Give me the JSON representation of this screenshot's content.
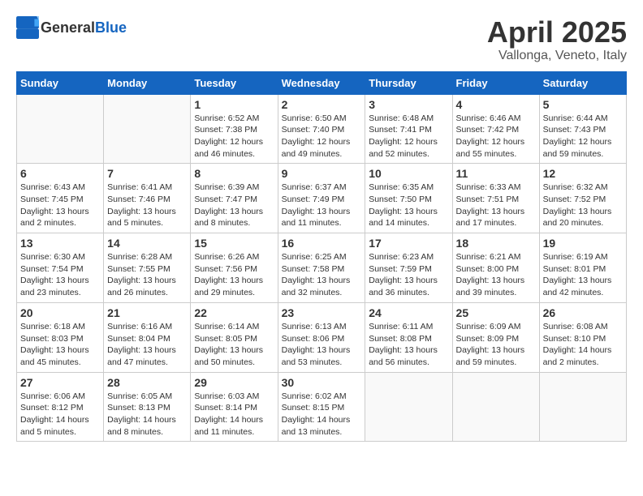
{
  "header": {
    "logo_general": "General",
    "logo_blue": "Blue",
    "month": "April 2025",
    "location": "Vallonga, Veneto, Italy"
  },
  "weekdays": [
    "Sunday",
    "Monday",
    "Tuesday",
    "Wednesday",
    "Thursday",
    "Friday",
    "Saturday"
  ],
  "weeks": [
    [
      {
        "day": "",
        "info": ""
      },
      {
        "day": "",
        "info": ""
      },
      {
        "day": "1",
        "info": "Sunrise: 6:52 AM\nSunset: 7:38 PM\nDaylight: 12 hours\nand 46 minutes."
      },
      {
        "day": "2",
        "info": "Sunrise: 6:50 AM\nSunset: 7:40 PM\nDaylight: 12 hours\nand 49 minutes."
      },
      {
        "day": "3",
        "info": "Sunrise: 6:48 AM\nSunset: 7:41 PM\nDaylight: 12 hours\nand 52 minutes."
      },
      {
        "day": "4",
        "info": "Sunrise: 6:46 AM\nSunset: 7:42 PM\nDaylight: 12 hours\nand 55 minutes."
      },
      {
        "day": "5",
        "info": "Sunrise: 6:44 AM\nSunset: 7:43 PM\nDaylight: 12 hours\nand 59 minutes."
      }
    ],
    [
      {
        "day": "6",
        "info": "Sunrise: 6:43 AM\nSunset: 7:45 PM\nDaylight: 13 hours\nand 2 minutes."
      },
      {
        "day": "7",
        "info": "Sunrise: 6:41 AM\nSunset: 7:46 PM\nDaylight: 13 hours\nand 5 minutes."
      },
      {
        "day": "8",
        "info": "Sunrise: 6:39 AM\nSunset: 7:47 PM\nDaylight: 13 hours\nand 8 minutes."
      },
      {
        "day": "9",
        "info": "Sunrise: 6:37 AM\nSunset: 7:49 PM\nDaylight: 13 hours\nand 11 minutes."
      },
      {
        "day": "10",
        "info": "Sunrise: 6:35 AM\nSunset: 7:50 PM\nDaylight: 13 hours\nand 14 minutes."
      },
      {
        "day": "11",
        "info": "Sunrise: 6:33 AM\nSunset: 7:51 PM\nDaylight: 13 hours\nand 17 minutes."
      },
      {
        "day": "12",
        "info": "Sunrise: 6:32 AM\nSunset: 7:52 PM\nDaylight: 13 hours\nand 20 minutes."
      }
    ],
    [
      {
        "day": "13",
        "info": "Sunrise: 6:30 AM\nSunset: 7:54 PM\nDaylight: 13 hours\nand 23 minutes."
      },
      {
        "day": "14",
        "info": "Sunrise: 6:28 AM\nSunset: 7:55 PM\nDaylight: 13 hours\nand 26 minutes."
      },
      {
        "day": "15",
        "info": "Sunrise: 6:26 AM\nSunset: 7:56 PM\nDaylight: 13 hours\nand 29 minutes."
      },
      {
        "day": "16",
        "info": "Sunrise: 6:25 AM\nSunset: 7:58 PM\nDaylight: 13 hours\nand 32 minutes."
      },
      {
        "day": "17",
        "info": "Sunrise: 6:23 AM\nSunset: 7:59 PM\nDaylight: 13 hours\nand 36 minutes."
      },
      {
        "day": "18",
        "info": "Sunrise: 6:21 AM\nSunset: 8:00 PM\nDaylight: 13 hours\nand 39 minutes."
      },
      {
        "day": "19",
        "info": "Sunrise: 6:19 AM\nSunset: 8:01 PM\nDaylight: 13 hours\nand 42 minutes."
      }
    ],
    [
      {
        "day": "20",
        "info": "Sunrise: 6:18 AM\nSunset: 8:03 PM\nDaylight: 13 hours\nand 45 minutes."
      },
      {
        "day": "21",
        "info": "Sunrise: 6:16 AM\nSunset: 8:04 PM\nDaylight: 13 hours\nand 47 minutes."
      },
      {
        "day": "22",
        "info": "Sunrise: 6:14 AM\nSunset: 8:05 PM\nDaylight: 13 hours\nand 50 minutes."
      },
      {
        "day": "23",
        "info": "Sunrise: 6:13 AM\nSunset: 8:06 PM\nDaylight: 13 hours\nand 53 minutes."
      },
      {
        "day": "24",
        "info": "Sunrise: 6:11 AM\nSunset: 8:08 PM\nDaylight: 13 hours\nand 56 minutes."
      },
      {
        "day": "25",
        "info": "Sunrise: 6:09 AM\nSunset: 8:09 PM\nDaylight: 13 hours\nand 59 minutes."
      },
      {
        "day": "26",
        "info": "Sunrise: 6:08 AM\nSunset: 8:10 PM\nDaylight: 14 hours\nand 2 minutes."
      }
    ],
    [
      {
        "day": "27",
        "info": "Sunrise: 6:06 AM\nSunset: 8:12 PM\nDaylight: 14 hours\nand 5 minutes."
      },
      {
        "day": "28",
        "info": "Sunrise: 6:05 AM\nSunset: 8:13 PM\nDaylight: 14 hours\nand 8 minutes."
      },
      {
        "day": "29",
        "info": "Sunrise: 6:03 AM\nSunset: 8:14 PM\nDaylight: 14 hours\nand 11 minutes."
      },
      {
        "day": "30",
        "info": "Sunrise: 6:02 AM\nSunset: 8:15 PM\nDaylight: 14 hours\nand 13 minutes."
      },
      {
        "day": "",
        "info": ""
      },
      {
        "day": "",
        "info": ""
      },
      {
        "day": "",
        "info": ""
      }
    ]
  ]
}
